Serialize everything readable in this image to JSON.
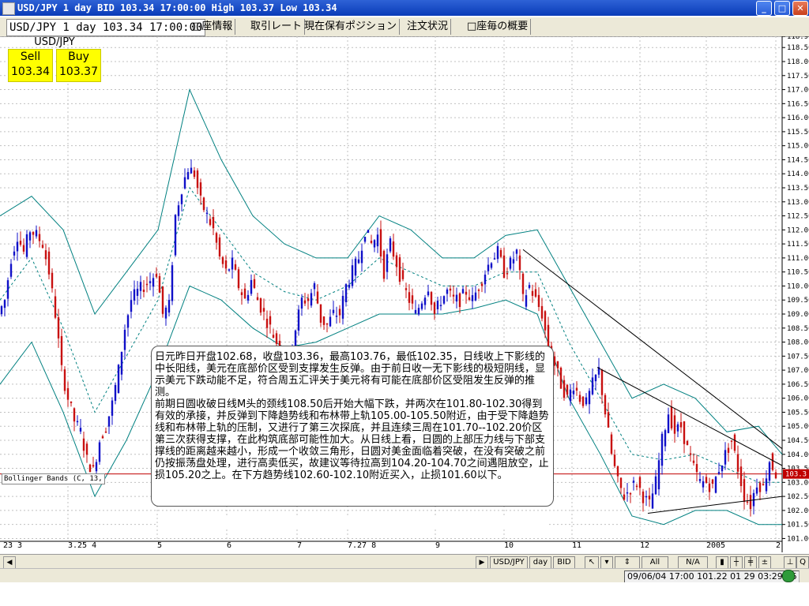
{
  "window": {
    "title": "USD/JPY 1 day BID 103.34 17:00:00 High 103.37 Low 103.34"
  },
  "tabs": {
    "symbol_tab": "USD/JPY 1 day 103.34 17:00:00",
    "items": [
      "□座情報",
      "取引レート",
      "現在保有ポジション",
      "注文状況",
      "□座毎の概要"
    ]
  },
  "quote": {
    "symbol": "USD/JPY",
    "sell_label": "Sell",
    "buy_label": "Buy",
    "sell": "103.34",
    "buy": "103.37"
  },
  "indicator": {
    "label": "Bollinger Bands (C, 13,"
  },
  "commentary": [
    "日元昨日开盘102.68，收盘103.36，最高103.76，最低102.35，日线收上下影线的中长阳线，美元在底部价区受到支撑发生反弹。由于前日收一无下影线的极短阴线，显示美元下跌动能不足，符合周五汇评关于美元将有可能在底部价区受阻发生反弹的推测。",
    "前期日圆收破日线M头的颈线108.50后开始大幅下跌，并两次在101.80-102.30得到有效的承接，并反弹到下降趋势线和布林带上轨105.00-105.50附近，由于受下降趋势线和布林带上轨的压制，又进行了第三次探底，并且连续三周在101.70--102.20价区第三次获得支撑，在此构筑底部可能性加大。从日线上看，日圆的上部压力线与下部支撑线的距离越来越小，形成一个收敛三角形，日圆对美金面临着突破，在没有突破之前仍按振荡盘处理，进行高卖低买，故建议等待拉高到104.20-104.70之间遇阻放空，止损105.20之上。在下方趋势线102.60-102.10附近买入，止损101.60以下。"
  ],
  "date_axis": [
    "23 3",
    "3.25 4",
    "5",
    "6",
    "7",
    "7.27 8",
    "9",
    "10",
    "11",
    "12",
    "2005",
    "2"
  ],
  "toolbar": {
    "symbol_btn": "USD/JPY",
    "period_btn": "day",
    "side_btn": "BID",
    "all_btn": "All",
    "na_btn": "N/A",
    "q_btn": "Q"
  },
  "status": {
    "text": "09/06/04 17:00  101.22 01 29 03:29:26"
  },
  "colors": {
    "up": "#1010c8",
    "down": "#c81010",
    "band": "#008080",
    "grid": "#c0c0c0",
    "current_line": "#c00000"
  },
  "chart_data": {
    "type": "candlestick",
    "title": "",
    "xlabel": "",
    "ylabel": "",
    "ylim": [
      100.9,
      118.9
    ],
    "y_ticks": [
      "118.90",
      "118.50",
      "118.00",
      "117.50",
      "117.00",
      "116.50",
      "116.00",
      "115.50",
      "115.00",
      "114.50",
      "114.00",
      "113.50",
      "113.00",
      "112.50",
      "112.00",
      "111.50",
      "111.00",
      "110.50",
      "110.00",
      "109.50",
      "109.00",
      "108.50",
      "108.00",
      "107.50",
      "107.00",
      "106.50",
      "106.00",
      "105.50",
      "105.00",
      "104.50",
      "104.00",
      "103.50",
      "103.00",
      "102.50",
      "102.00",
      "101.50",
      "101.00"
    ],
    "last_price": "103.3",
    "x_labels": [
      "23 3",
      "3.25 4",
      "5",
      "6",
      "7",
      "7.27 8",
      "9",
      "10",
      "11",
      "12",
      "2005",
      "2"
    ],
    "close_path": [
      [
        0,
        109.0
      ],
      [
        8,
        109.5
      ],
      [
        16,
        111.0
      ],
      [
        24,
        111.8
      ],
      [
        32,
        111.2
      ],
      [
        40,
        112.0
      ],
      [
        48,
        111.8
      ],
      [
        56,
        111.5
      ],
      [
        64,
        110.5
      ],
      [
        72,
        109.0
      ],
      [
        80,
        107.0
      ],
      [
        88,
        106.0
      ],
      [
        96,
        105.2
      ],
      [
        104,
        104.8
      ],
      [
        112,
        103.8
      ],
      [
        120,
        103.4
      ],
      [
        128,
        104.5
      ],
      [
        136,
        105.0
      ],
      [
        144,
        105.8
      ],
      [
        152,
        107.0
      ],
      [
        160,
        108.5
      ],
      [
        168,
        109.5
      ],
      [
        176,
        109.8
      ],
      [
        184,
        110.0
      ],
      [
        192,
        110.2
      ],
      [
        200,
        110.5
      ],
      [
        208,
        109.0
      ],
      [
        216,
        109.3
      ],
      [
        224,
        112.5
      ],
      [
        232,
        113.5
      ],
      [
        240,
        114.2
      ],
      [
        248,
        114.0
      ],
      [
        256,
        113.0
      ],
      [
        264,
        112.5
      ],
      [
        272,
        112.0
      ],
      [
        280,
        111.0
      ],
      [
        288,
        110.5
      ],
      [
        296,
        110.8
      ],
      [
        304,
        110.0
      ],
      [
        312,
        109.5
      ],
      [
        320,
        110.2
      ],
      [
        328,
        109.5
      ],
      [
        336,
        109.0
      ],
      [
        344,
        108.5
      ],
      [
        352,
        108.0
      ],
      [
        360,
        107.4
      ],
      [
        368,
        107.6
      ],
      [
        376,
        108.5
      ],
      [
        384,
        109.5
      ],
      [
        392,
        109.5
      ],
      [
        400,
        110.0
      ],
      [
        408,
        108.8
      ],
      [
        416,
        108.6
      ],
      [
        424,
        109.0
      ],
      [
        432,
        109.0
      ],
      [
        440,
        110.0
      ],
      [
        448,
        110.5
      ],
      [
        456,
        111.0
      ],
      [
        464,
        112.0
      ],
      [
        472,
        111.5
      ],
      [
        480,
        111.8
      ],
      [
        488,
        110.5
      ],
      [
        496,
        111.5
      ],
      [
        504,
        110.8
      ],
      [
        512,
        110.0
      ],
      [
        520,
        109.5
      ],
      [
        528,
        109.0
      ],
      [
        536,
        109.5
      ],
      [
        544,
        110.0
      ],
      [
        552,
        109.0
      ],
      [
        560,
        109.5
      ],
      [
        568,
        109.8
      ],
      [
        576,
        109.5
      ],
      [
        584,
        109.5
      ],
      [
        592,
        109.8
      ],
      [
        600,
        109.5
      ],
      [
        608,
        110.0
      ],
      [
        616,
        110.5
      ],
      [
        624,
        111.0
      ],
      [
        632,
        111.2
      ],
      [
        640,
        110.5
      ],
      [
        648,
        110.8
      ],
      [
        656,
        111.2
      ],
      [
        664,
        109.5
      ],
      [
        672,
        110.0
      ],
      [
        680,
        109.5
      ],
      [
        688,
        109.0
      ],
      [
        696,
        107.8
      ],
      [
        704,
        107.2
      ],
      [
        712,
        106.5
      ],
      [
        720,
        106.0
      ],
      [
        728,
        106.5
      ],
      [
        736,
        106.0
      ],
      [
        744,
        105.8
      ],
      [
        752,
        106.5
      ],
      [
        760,
        107.0
      ],
      [
        768,
        105.5
      ],
      [
        776,
        104.0
      ],
      [
        784,
        103.0
      ],
      [
        792,
        102.5
      ],
      [
        800,
        102.8
      ],
      [
        808,
        103.0
      ],
      [
        816,
        102.5
      ],
      [
        824,
        102.2
      ],
      [
        832,
        103.0
      ],
      [
        840,
        104.5
      ],
      [
        848,
        105.5
      ],
      [
        856,
        104.8
      ],
      [
        864,
        105.0
      ],
      [
        872,
        104.2
      ],
      [
        880,
        103.5
      ],
      [
        888,
        103.0
      ],
      [
        896,
        103.0
      ],
      [
        904,
        102.8
      ],
      [
        912,
        103.5
      ],
      [
        920,
        104.0
      ],
      [
        928,
        104.5
      ],
      [
        936,
        103.5
      ],
      [
        944,
        102.5
      ],
      [
        952,
        102.2
      ],
      [
        960,
        103.0
      ],
      [
        968,
        102.8
      ],
      [
        976,
        103.8
      ],
      [
        984,
        103.3
      ]
    ],
    "bands": {
      "upper": [
        [
          0,
          112.5
        ],
        [
          40,
          113.2
        ],
        [
          80,
          112.0
        ],
        [
          120,
          109.0
        ],
        [
          160,
          110.5
        ],
        [
          200,
          112.0
        ],
        [
          240,
          117.0
        ],
        [
          280,
          114.5
        ],
        [
          320,
          112.5
        ],
        [
          360,
          111.5
        ],
        [
          400,
          111.0
        ],
        [
          440,
          111.0
        ],
        [
          480,
          112.5
        ],
        [
          520,
          112.0
        ],
        [
          560,
          111.0
        ],
        [
          600,
          111.0
        ],
        [
          640,
          111.8
        ],
        [
          680,
          112.0
        ],
        [
          720,
          110.0
        ],
        [
          760,
          108.0
        ],
        [
          800,
          106.0
        ],
        [
          840,
          106.5
        ],
        [
          880,
          106.0
        ],
        [
          920,
          104.8
        ],
        [
          960,
          105.0
        ],
        [
          990,
          104.0
        ]
      ],
      "middle": [
        [
          0,
          109.5
        ],
        [
          40,
          111.0
        ],
        [
          80,
          108.5
        ],
        [
          120,
          105.5
        ],
        [
          160,
          107.5
        ],
        [
          200,
          109.5
        ],
        [
          240,
          113.5
        ],
        [
          280,
          112.0
        ],
        [
          320,
          110.5
        ],
        [
          360,
          109.8
        ],
        [
          400,
          109.5
        ],
        [
          440,
          110.0
        ],
        [
          480,
          111.0
        ],
        [
          520,
          110.5
        ],
        [
          560,
          110.0
        ],
        [
          600,
          110.0
        ],
        [
          640,
          110.5
        ],
        [
          680,
          110.5
        ],
        [
          720,
          108.0
        ],
        [
          760,
          106.0
        ],
        [
          800,
          104.0
        ],
        [
          840,
          103.8
        ],
        [
          880,
          104.0
        ],
        [
          920,
          103.5
        ],
        [
          960,
          103.0
        ],
        [
          990,
          103.0
        ]
      ],
      "lower": [
        [
          0,
          106.5
        ],
        [
          40,
          108.0
        ],
        [
          80,
          105.5
        ],
        [
          120,
          102.5
        ],
        [
          160,
          104.5
        ],
        [
          200,
          107.0
        ],
        [
          240,
          110.0
        ],
        [
          280,
          109.5
        ],
        [
          320,
          108.5
        ],
        [
          360,
          107.8
        ],
        [
          400,
          108.0
        ],
        [
          440,
          108.5
        ],
        [
          480,
          109.0
        ],
        [
          520,
          109.0
        ],
        [
          560,
          109.0
        ],
        [
          600,
          109.2
        ],
        [
          640,
          109.5
        ],
        [
          680,
          109.0
        ],
        [
          720,
          106.0
        ],
        [
          760,
          104.0
        ],
        [
          800,
          101.8
        ],
        [
          840,
          101.5
        ],
        [
          880,
          102.0
        ],
        [
          920,
          102.0
        ],
        [
          960,
          101.5
        ],
        [
          990,
          101.5
        ]
      ]
    },
    "trendlines": [
      [
        [
          662,
          111.3
        ],
        [
          990,
          104.2
        ]
      ],
      [
        [
          756,
          107.1
        ],
        [
          990,
          103.6
        ]
      ],
      [
        [
          820,
          101.9
        ],
        [
          990,
          102.5
        ]
      ]
    ]
  }
}
